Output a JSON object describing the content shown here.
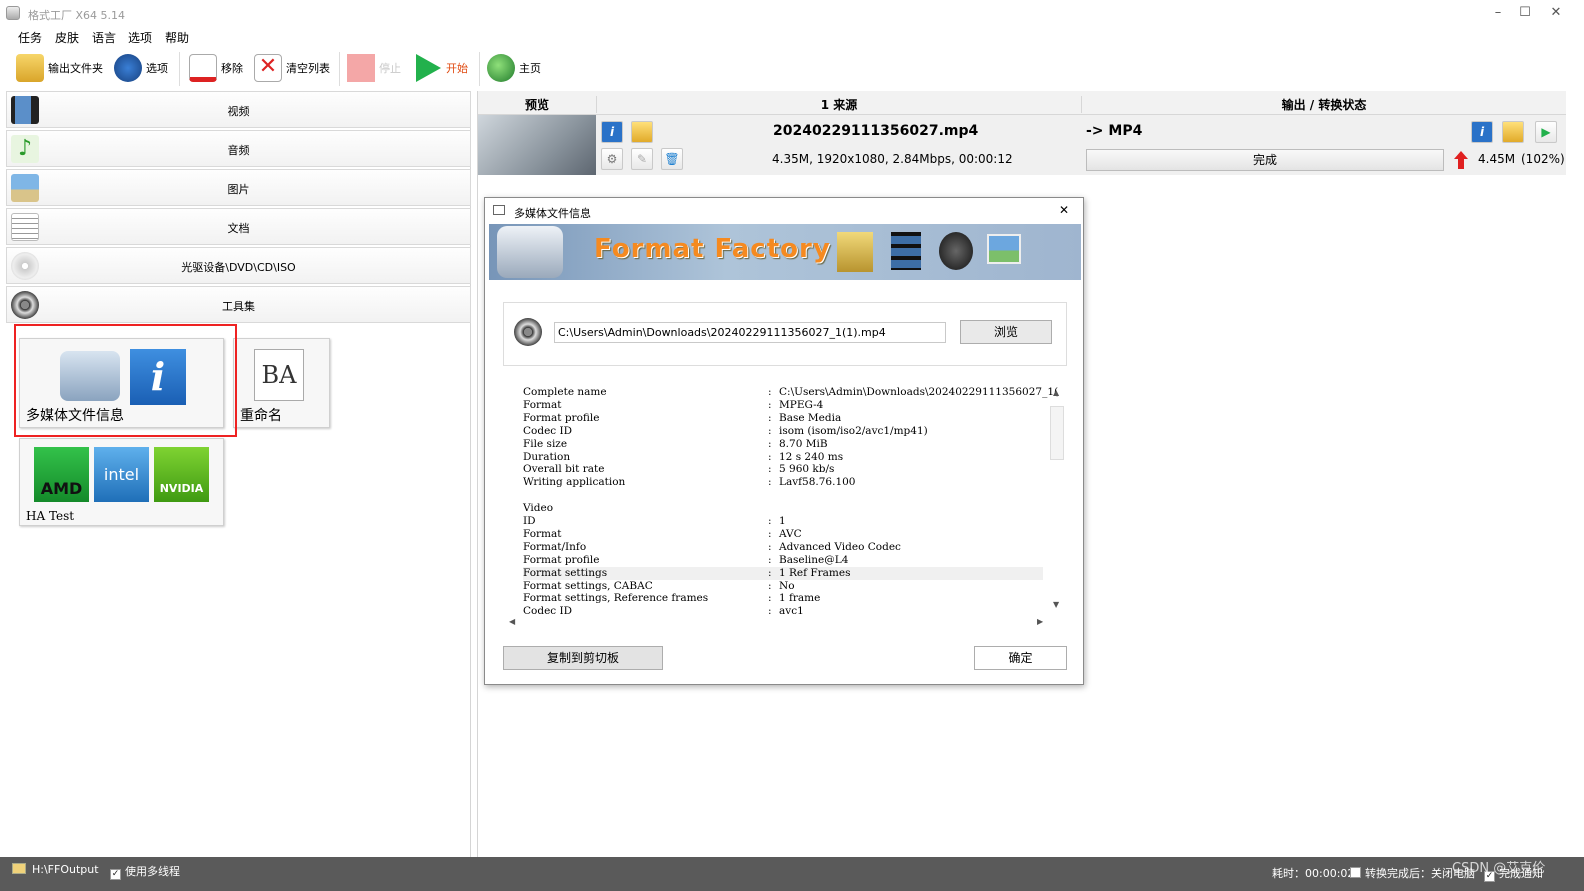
{
  "window": {
    "title": "格式工厂 X64 5.14",
    "minimize": "–",
    "maximize": "☐",
    "close": "✕"
  },
  "menu": [
    "任务",
    "皮肤",
    "语言",
    "选项",
    "帮助"
  ],
  "toolbar": {
    "output_folder": "输出文件夹",
    "options": "选项",
    "remove": "移除",
    "clear_list": "清空列表",
    "stop": "停止",
    "start": "开始",
    "home": "主页"
  },
  "categories": [
    "视频",
    "音频",
    "图片",
    "文档",
    "光驱设备\\DVD\\CD\\ISO",
    "工具集"
  ],
  "tools": {
    "media_info": "多媒体文件信息",
    "rename": "重命名",
    "ha_test": "HA Test",
    "amd": "AMD",
    "intel": "intel",
    "nvidia": "NVIDIA"
  },
  "task_header": {
    "preview": "预览",
    "source": "1 来源",
    "output": "输出 / 转换状态"
  },
  "task": {
    "filename": "20240229111356027.mp4",
    "details": "4.35M, 1920x1080, 2.84Mbps, 00:00:12",
    "target": "-> MP4",
    "status": "完成",
    "output_size": "4.45M",
    "output_ratio": "(102%)"
  },
  "dialog": {
    "title": "多媒体文件信息",
    "banner": "Format Factory",
    "path": "C:\\Users\\Admin\\Downloads\\20240229111356027_1(1).mp4",
    "browse": "浏览",
    "copy": "复制到剪切板",
    "ok": "确定",
    "close": "✕",
    "info": [
      {
        "k": "Complete name",
        "v": "C:\\Users\\Admin\\Downloads\\20240229111356027_1("
      },
      {
        "k": "Format",
        "v": "MPEG-4"
      },
      {
        "k": "Format profile",
        "v": "Base Media"
      },
      {
        "k": "Codec ID",
        "v": "isom (isom/iso2/avc1/mp41)"
      },
      {
        "k": "File size",
        "v": "8.70 MiB"
      },
      {
        "k": "Duration",
        "v": "12 s 240 ms"
      },
      {
        "k": "Overall bit rate",
        "v": "5 960 kb/s"
      },
      {
        "k": "Writing application",
        "v": "Lavf58.76.100"
      },
      {
        "k": "",
        "v": ""
      },
      {
        "k": "Video",
        "v": ""
      },
      {
        "k": "ID",
        "v": "1"
      },
      {
        "k": "Format",
        "v": "AVC"
      },
      {
        "k": "Format/Info",
        "v": "Advanced Video Codec"
      },
      {
        "k": "Format profile",
        "v": "Baseline@L4"
      },
      {
        "k": "Format settings",
        "v": "1 Ref Frames"
      },
      {
        "k": "Format settings, CABAC",
        "v": "No"
      },
      {
        "k": "Format settings, Reference frames",
        "v": "1 frame"
      },
      {
        "k": "Codec ID",
        "v": "avc1"
      }
    ]
  },
  "statusbar": {
    "output_path": "H:\\FFOutput",
    "multithread": "使用多线程",
    "elapsed": "耗时：00:00:02",
    "after_convert": "转换完成后：关闭电脑",
    "complete_notify": "完成通知",
    "watermark": "CSDN @艾克伦"
  },
  "colors": {
    "accent_red": "#ee2222",
    "start_green": "#22b14c",
    "status_bar": "#5a5a5a"
  }
}
